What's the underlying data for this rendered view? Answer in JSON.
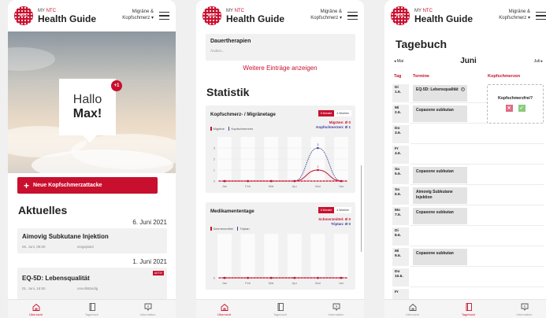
{
  "header": {
    "logo_text": "NTC",
    "brand_small_prefix": "MY",
    "brand_small_accent": "NTC",
    "brand_title": "Health Guide",
    "topic_line1": "Migräne &",
    "topic_line2": "Kopfschmerz"
  },
  "nav": [
    {
      "label": "Übersicht",
      "icon": "home-icon"
    },
    {
      "label": "Tagebuch",
      "icon": "book-icon"
    },
    {
      "label": "Information",
      "icon": "info-chat-icon"
    }
  ],
  "home": {
    "greeting": "Hallo",
    "name": "Max!",
    "badge": "+1",
    "new_attack_label": "Neue Kopfschmerzattacke",
    "news_title": "Aktuelles",
    "groups": [
      {
        "date": "6. Juni 2021",
        "title": "Aimovig Subkutane Injektion",
        "meta_date": "06. Juni, 09:00",
        "meta_status": "eingeplant",
        "tag": ""
      },
      {
        "date": "1. Juni 2021",
        "title": "EQ-5D: Lebensqualität",
        "meta_date": "01. Juni, 15:50",
        "meta_status": "unvollständig",
        "tag": "AKTIV"
      }
    ]
  },
  "stats": {
    "dauer_title": "Dauertherapien",
    "dauer_item": "Ändern...",
    "more_label": "Weitere Einträge anzeigen",
    "section_title": "Statistik",
    "toggle_on": "6 Monate",
    "toggle_off": "4 Wochen"
  },
  "chart_data": [
    {
      "type": "line",
      "title": "Kopfschmerz- / Migränetage",
      "summary": [
        "Migräne: Ø 0",
        "Kopfschmerzen: Ø 1"
      ],
      "categories": [
        "Jan",
        "Feb",
        "Mär",
        "Apr",
        "Mai",
        "Jun"
      ],
      "ylim": [
        0,
        4
      ],
      "yticks": [
        0,
        1,
        2,
        3
      ],
      "grid": true,
      "legend_position": "top-left",
      "series": [
        {
          "name": "Migräne",
          "color": "#c8102e",
          "values": [
            0,
            0,
            0,
            0,
            1,
            0
          ]
        },
        {
          "name": "Kopfschmerzen",
          "color": "#3a3a9a",
          "values": [
            0,
            0,
            0,
            0,
            3,
            0
          ]
        }
      ],
      "point_labels": [
        {
          "series": "Kopfschmerzen",
          "index": 4,
          "label": "3"
        },
        {
          "series": "Migräne",
          "index": 4,
          "label": "1"
        }
      ]
    },
    {
      "type": "line",
      "title": "Medikamententage",
      "summary": [
        "Schmerzmittel: Ø 0",
        "Triptan: Ø 0"
      ],
      "categories": [
        "Jan",
        "Feb",
        "Mär",
        "Apr",
        "Mai",
        "Jun"
      ],
      "ylim": [
        0,
        4
      ],
      "grid": true,
      "legend_position": "top-left",
      "series": [
        {
          "name": "Schmerzmittel",
          "color": "#c8102e",
          "values": [
            0,
            0,
            0,
            0,
            0,
            0
          ]
        },
        {
          "name": "Triptan",
          "color": "#3a3a9a",
          "values": [
            0,
            0,
            0,
            0,
            0,
            0
          ]
        }
      ]
    }
  ],
  "diary": {
    "title": "Tagebuch",
    "prev_month": "Mai",
    "current_month": "Juni",
    "next_month": "Juli",
    "col_day": "Tag",
    "col_appointments": "Termine",
    "col_headache": "Kopfschmerzen",
    "headache_question": "Kopfschmerzfrei?",
    "days": [
      {
        "wd": "Di",
        "d": "1.6.",
        "term": "EQ-5D: Lebensqualität",
        "info": true
      },
      {
        "wd": "Mi",
        "d": "2.6.",
        "term": "Copaxone subkutan",
        "info": false
      },
      {
        "wd": "Do",
        "d": "3.6.",
        "term": "",
        "info": false
      },
      {
        "wd": "Fr",
        "d": "4.6.",
        "term": "",
        "info": false
      },
      {
        "wd": "Sa",
        "d": "5.6.",
        "term": "Copaxone subkutan",
        "info": false
      },
      {
        "wd": "So",
        "d": "6.6.",
        "term": "Aimovig Subkutane Injektion",
        "info": false
      },
      {
        "wd": "Mo",
        "d": "7.6.",
        "term": "Copaxone subkutan",
        "info": false
      },
      {
        "wd": "Di",
        "d": "8.6.",
        "term": "",
        "info": false
      },
      {
        "wd": "Mi",
        "d": "9.6.",
        "term": "Copaxone subkutan",
        "info": false
      },
      {
        "wd": "Do",
        "d": "10.6.",
        "term": "",
        "info": false
      },
      {
        "wd": "Fr",
        "d": "",
        "term": "",
        "info": false
      }
    ]
  }
}
